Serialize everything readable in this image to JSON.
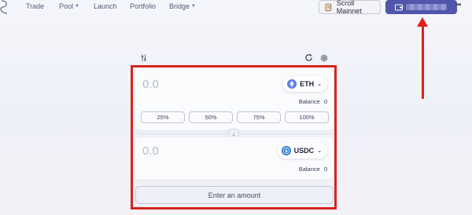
{
  "nav": {
    "items": [
      {
        "label": "Trade",
        "has_caret": false
      },
      {
        "label": "Pool",
        "has_caret": true
      },
      {
        "label": "Launch",
        "has_caret": false
      },
      {
        "label": "Portfolio",
        "has_caret": false
      },
      {
        "label": "Bridge",
        "has_caret": true
      }
    ]
  },
  "network_button": {
    "label": "Scroll Mainnet",
    "icon": "scroll-icon"
  },
  "wallet_button": {
    "icon": "wallet-icon",
    "address": "(blurred)"
  },
  "swap": {
    "from": {
      "amount": "0.0",
      "token": "ETH",
      "balance_label": "Balance",
      "balance_value": "0"
    },
    "percent_buttons": [
      "25%",
      "50%",
      "75%",
      "100%"
    ],
    "to": {
      "amount": "0.0",
      "token": "USDC",
      "balance_label": "Balance",
      "balance_value": "0"
    },
    "submit_label": "Enter an amount"
  },
  "colors": {
    "accent": "#5156ab",
    "annotation": "#d32520",
    "eth": "#627eea",
    "usdc": "#2775ca"
  }
}
